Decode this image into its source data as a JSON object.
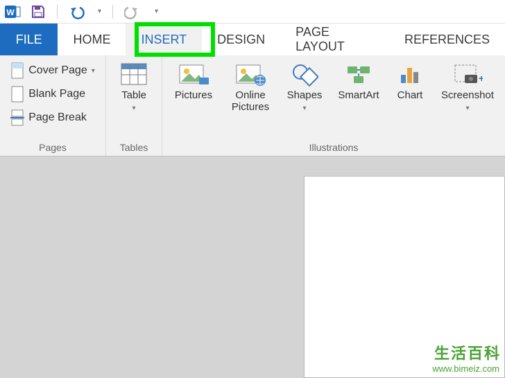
{
  "qat": {
    "app_icon": "word-icon",
    "save_icon": "save-icon",
    "undo_icon": "undo-icon",
    "redo_icon": "redo-icon"
  },
  "tabs": {
    "file": "FILE",
    "home": "HOME",
    "insert": "INSERT",
    "design": "DESIGN",
    "page_layout": "PAGE LAYOUT",
    "references": "REFERENCES",
    "active": "insert"
  },
  "ribbon": {
    "pages": {
      "label": "Pages",
      "cover_page": "Cover Page",
      "blank_page": "Blank Page",
      "page_break": "Page Break"
    },
    "tables": {
      "label": "Tables",
      "table": "Table"
    },
    "illustrations": {
      "label": "Illustrations",
      "pictures": "Pictures",
      "online_pictures": "Online\nPictures",
      "shapes": "Shapes",
      "smartart": "SmartArt",
      "chart": "Chart",
      "screenshot": "Screenshot"
    }
  },
  "watermark": {
    "main": "生活百科",
    "sub": "www.bimeiz.com"
  }
}
